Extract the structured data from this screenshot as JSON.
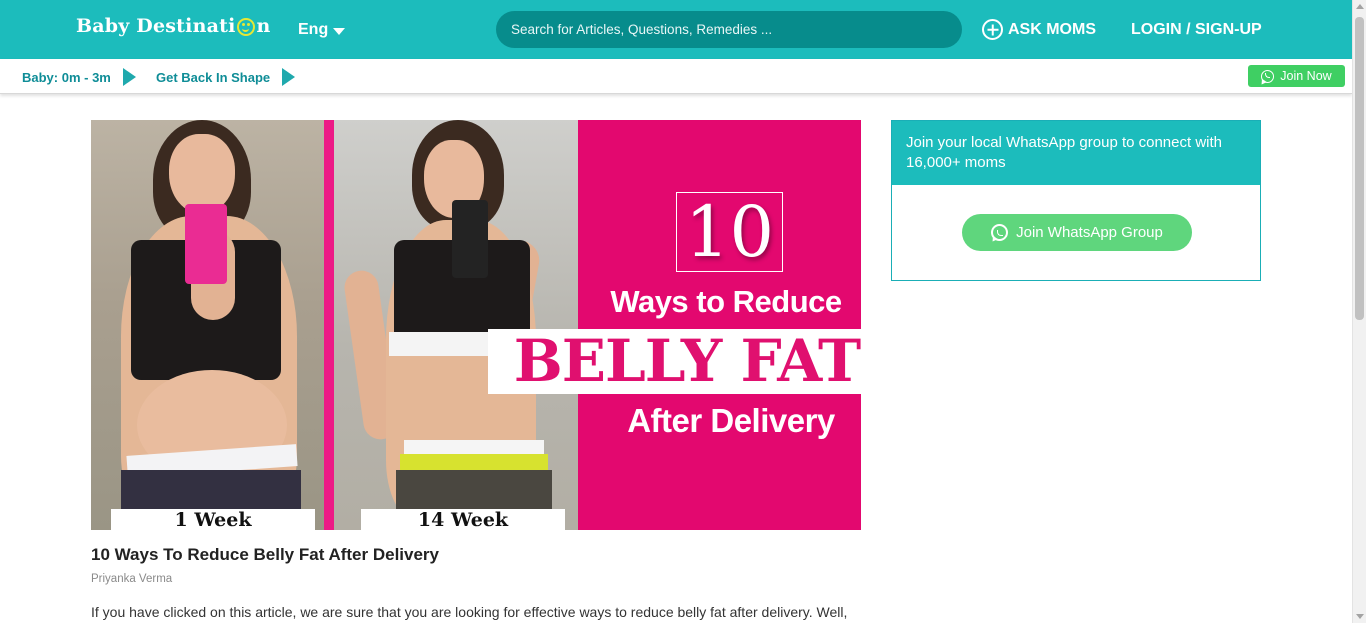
{
  "header": {
    "logo_text": "Baby Destinati",
    "logo_tail": "n",
    "language": "Eng",
    "search_placeholder": "Search for Articles, Questions, Remedies ...",
    "ask_moms": "ASK MOMS",
    "login": "LOGIN / SIGN-UP",
    "accent_color": "#1cbcbc"
  },
  "subnav": {
    "items": [
      {
        "label": "Baby: 0m - 3m"
      },
      {
        "label": "Get Back In Shape"
      }
    ],
    "join_now": "Join Now"
  },
  "hero": {
    "number": "10",
    "line1": "Ways to Reduce",
    "line2": "BELLY FAT",
    "line3": "After Delivery",
    "week_left": "1 Week",
    "week_right": "14 Week",
    "brand_color": "#e3086f"
  },
  "article": {
    "title": "10 Ways To Reduce Belly Fat After Delivery",
    "author": "Priyanka Verma",
    "intro": "If you have clicked on this article, we are sure that you are looking for effective ways to reduce belly fat after delivery. Well,"
  },
  "whatsapp_card": {
    "heading": "Join your local WhatsApp group to connect with 16,000+ moms",
    "button": "Join WhatsApp Group",
    "button_color": "#5fd67d"
  },
  "icons": [
    "caret-down-icon",
    "plus-circle-icon",
    "chevron-right-icon",
    "whatsapp-icon"
  ]
}
